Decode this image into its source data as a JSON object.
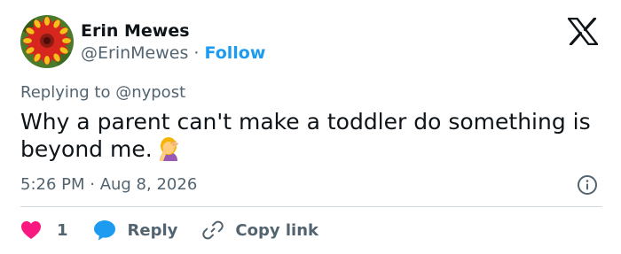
{
  "author": {
    "name": "Erin Mewes",
    "handle": "@ErinMewes",
    "separator": "·",
    "follow_label": "Follow",
    "avatar_icon": "flower-avatar"
  },
  "brand": {
    "logo_icon": "x-logo-icon"
  },
  "tweet": {
    "replying_to": "Replying to @nypost",
    "text": "Why a parent can't make a toddler do something is beyond me.",
    "emoji_icon": "facepalm-emoji",
    "timestamp": "5:26 PM · Aug 8, 2026"
  },
  "actions": {
    "like_count": "1",
    "reply_label": "Reply",
    "copy_link_label": "Copy link"
  },
  "colors": {
    "accent": "#1d9bf0",
    "like": "#f91880",
    "text_primary": "#0f1419",
    "text_secondary": "#536471",
    "divider": "#cfd9de"
  }
}
